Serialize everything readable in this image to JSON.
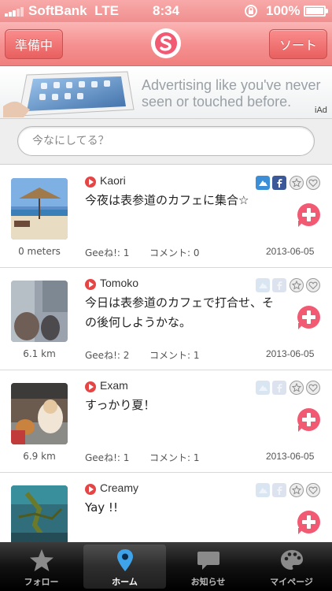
{
  "status_bar": {
    "carrier": "SoftBank",
    "network": "LTE",
    "time": "8:34",
    "battery": "100%"
  },
  "nav": {
    "left_button": "準備中",
    "right_button": "ソート",
    "logo_icon": "s-logo-icon",
    "accent_color": "#f28a8a"
  },
  "ad": {
    "line1": "Advertising like you've never",
    "line2": "seen or touched before.",
    "badge": "iAd"
  },
  "search": {
    "placeholder": "今なにしてる？"
  },
  "posts": [
    {
      "user": "Kaori",
      "message": "今夜は表参道のカフェに集合☆",
      "distance": "0 meters",
      "likes": "Geeね!: 1",
      "comments": "コメント: 0",
      "date": "2013-06-05",
      "icons": [
        "cloud-icon",
        "facebook-icon",
        "star-icon",
        "heart-icon"
      ],
      "active_services": true
    },
    {
      "user": "Tomoko",
      "message": "今日は表参道のカフェで打合せ、その後何しようかな。",
      "distance": "6.1 km",
      "likes": "Geeね!: 2",
      "comments": "コメント: 1",
      "date": "2013-06-05",
      "icons": [
        "cloud-icon",
        "facebook-icon",
        "star-icon",
        "heart-icon"
      ],
      "active_services": false
    },
    {
      "user": "Exam",
      "message": "すっかり夏！",
      "distance": "6.9 km",
      "likes": "Geeね!: 1",
      "comments": "コメント: 1",
      "date": "2013-06-05",
      "icons": [
        "cloud-icon",
        "facebook-icon",
        "star-icon",
        "heart-icon"
      ],
      "active_services": false
    },
    {
      "user": "Creamy",
      "message": "Yay !!",
      "distance": "",
      "likes": "",
      "comments": "",
      "date": "",
      "icons": [
        "cloud-icon",
        "facebook-icon",
        "star-icon",
        "heart-icon"
      ],
      "active_services": false
    }
  ],
  "tabs": [
    {
      "label": "フォロー",
      "icon": "star-icon",
      "active": false
    },
    {
      "label": "ホーム",
      "icon": "map-pin-icon",
      "active": true
    },
    {
      "label": "お知らせ",
      "icon": "speech-bubble-icon",
      "active": false
    },
    {
      "label": "マイページ",
      "icon": "palette-icon",
      "active": false
    }
  ]
}
